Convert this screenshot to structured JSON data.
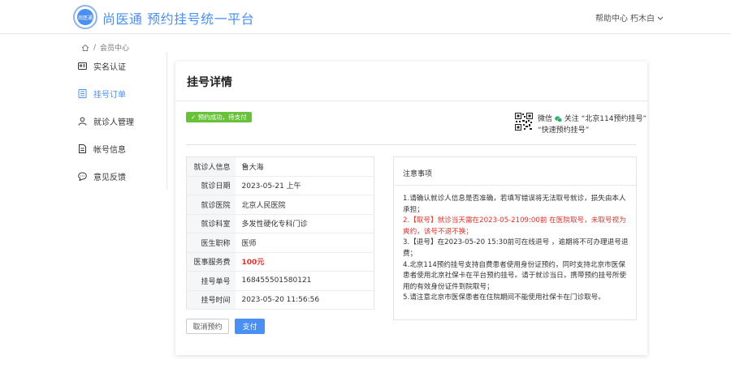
{
  "header": {
    "logo_text": "尚医通",
    "title": "尚医通 预约挂号统一平台",
    "help": "帮助中心",
    "user": "朽木白"
  },
  "breadcrumb": {
    "separator": "/",
    "current": "会员中心"
  },
  "sidebar": {
    "items": [
      {
        "label": "实名认证",
        "icon": "id-card-icon"
      },
      {
        "label": "挂号订单",
        "icon": "order-list-icon"
      },
      {
        "label": "就诊人管理",
        "icon": "user-icon"
      },
      {
        "label": "帐号信息",
        "icon": "document-icon"
      },
      {
        "label": "意见反馈",
        "icon": "chat-icon"
      }
    ]
  },
  "detail": {
    "title": "挂号详情",
    "status": "预约成功，待支付",
    "wechat_prefix": "微信",
    "wechat_text": "关注 “北京114预约挂号”",
    "wechat_text2": "“快速预约挂号”",
    "fields": [
      {
        "label": "就诊人信息",
        "value": "鲁大海"
      },
      {
        "label": "就诊日期",
        "value": "2023-05-21 上午"
      },
      {
        "label": "就诊医院",
        "value": "北京人民医院"
      },
      {
        "label": "就诊科室",
        "value": "多发性硬化专科门诊"
      },
      {
        "label": "医生职称",
        "value": "医师"
      },
      {
        "label": "医事服务费",
        "value": "100元"
      },
      {
        "label": "挂号单号",
        "value": "168455501580121"
      },
      {
        "label": "挂号时间",
        "value": "2023-05-20 11:56:56"
      }
    ],
    "cancel_label": "取消预约",
    "pay_label": "支付"
  },
  "notice": {
    "title": "注意事项",
    "lines": [
      "1.请确认就诊人信息是否准确，若填写错误将无法取号就诊，损失由本人承担；",
      "2.【取号】就诊当天需在2023-05-2109:00前 在医院取号，未取号视为爽约，该号不退不换；",
      "3.【退号】在2023-05-20 15:30前可在线退号 ，逾期将不可办理退号退费；",
      "4.北京114预约挂号支持自费患者使用身份证预约，同时支持北京市医保患者使用北京社保卡在平台预约挂号。请于就诊当日，携带预约挂号所使用的有效身份证件到院取号；",
      "5.请注意北京市医保患者在住院期间不能使用社保卡在门诊取号。"
    ]
  },
  "colors": {
    "accent": "#4a8ff2",
    "success": "#67c23a",
    "danger": "#e0312b"
  }
}
